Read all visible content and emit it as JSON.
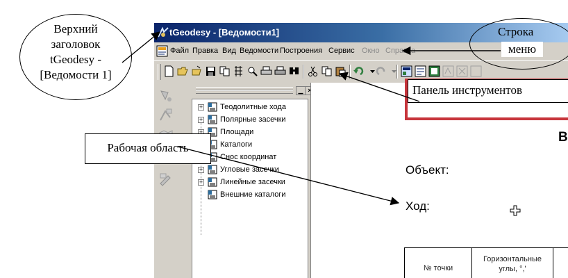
{
  "window": {
    "title": "tGeodesy - [Ведомости1]",
    "menu": [
      "Файл",
      "Правка",
      "Вид",
      "Ведомости",
      "Построения",
      "Сервис",
      "Окно",
      "Справка"
    ]
  },
  "tree": {
    "items": [
      {
        "label": "Теодолитные хода",
        "expandable": true
      },
      {
        "label": "Полярные засечки",
        "expandable": true
      },
      {
        "label": "Площади",
        "expandable": true
      },
      {
        "label": "Каталоги",
        "expandable": true
      },
      {
        "label": "Снос координат",
        "expandable": true
      },
      {
        "label": "Угловые засечки",
        "expandable": true
      },
      {
        "label": "Линейные засечки",
        "expandable": true
      },
      {
        "label": "Внешние каталоги",
        "expandable": false
      }
    ]
  },
  "document": {
    "heading_letter": "В",
    "object_label": "Объект:",
    "route_label": "Ход:",
    "table": {
      "headers": [
        "№ точки",
        "Горизонтальные углы, °,'"
      ]
    }
  },
  "callouts": {
    "title_callout": [
      "Верхний",
      "заголовок",
      "tGeodesy -",
      "[Ведомости 1]"
    ],
    "menu_callout_1": "Строка",
    "menu_callout_2": "меню",
    "toolbar_callout": "Панель инструментов",
    "workarea_callout": "Рабочая область"
  },
  "colors": {
    "title_gradient_start": "#0a246a",
    "title_gradient_end": "#a6caf0",
    "highlight_red": "#c7353c",
    "window_face": "#d4d0c8"
  }
}
